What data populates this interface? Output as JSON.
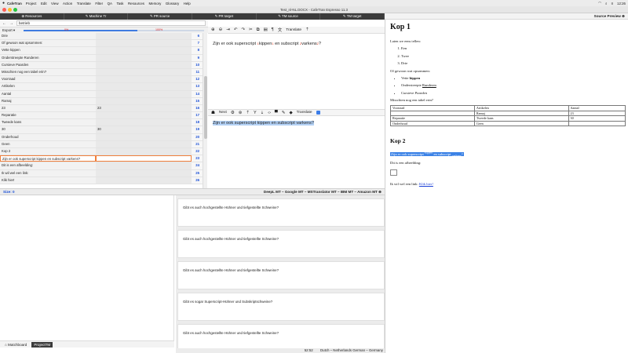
{
  "menubar": {
    "apple": "",
    "app": "CafeTran",
    "items": [
      "Project",
      "Edit",
      "View",
      "Action",
      "Translate",
      "Filter",
      "QA",
      "Task",
      "Resources",
      "Memory",
      "Glossary",
      "Help"
    ],
    "clock": "12:26"
  },
  "window": {
    "title": "Test_nl-NL.DOCX - CafeTran Espresso 11.3"
  },
  "tabs": [
    "⊕ Resources",
    "✎ Machine Tr",
    "✎ PR source",
    "✎ PR target",
    "✎ TM source",
    "✎ TM target"
  ],
  "preview_title": "Source Preview ⊕",
  "search": {
    "value": "betrieb"
  },
  "export": {
    "label": "Export ▾",
    "progress_fraction": 0.63,
    "pct_left": "0%",
    "pct_right": "100%"
  },
  "segments": [
    {
      "src": "Drie",
      "tgt": "",
      "num": "6"
    },
    {
      "src": "Of gewoon wat opsommen:",
      "tgt": "",
      "num": "7"
    },
    {
      "src": "Vette kippen",
      "tgt": "",
      "num": "8"
    },
    {
      "src": "Onderstreepte Runderen",
      "tgt": "",
      "num": "9"
    },
    {
      "src": "Cursieve Paarden",
      "tgt": "",
      "num": "10"
    },
    {
      "src": "Misschien nog een tabel erin?",
      "tgt": "",
      "num": "11"
    },
    {
      "src": "Voorraad",
      "tgt": "",
      "num": "12"
    },
    {
      "src": "Artikelen",
      "tgt": "",
      "num": "13"
    },
    {
      "src": "Aantal",
      "tgt": "",
      "num": "14"
    },
    {
      "src": "Ramaj",
      "tgt": "",
      "num": "15"
    },
    {
      "src": "23",
      "tgt": "23",
      "num": "16"
    },
    {
      "src": "Reparatie",
      "tgt": "",
      "num": "17"
    },
    {
      "src": "Tweede kans",
      "tgt": "",
      "num": "18"
    },
    {
      "src": "30",
      "tgt": "30",
      "num": "19"
    },
    {
      "src": "Onderhoud",
      "tgt": "",
      "num": "20"
    },
    {
      "src": "Geen",
      "tgt": "",
      "num": "21"
    },
    {
      "src": "Kop 2",
      "tgt": "",
      "num": "22"
    },
    {
      "src": "Zijn er ook superscript kippen en subscript varkens?",
      "tgt": "",
      "num": "23",
      "active": true
    },
    {
      "src": "Dit is een afbeelding:",
      "tgt": "",
      "num": "24"
    },
    {
      "src": "Ik wil wel een link:",
      "tgt": "",
      "num": "25"
    },
    {
      "src": "Klik hier!",
      "tgt": "",
      "num": "26"
    }
  ],
  "src_toolbar": {
    "translate_label": "Translate"
  },
  "source_editor": {
    "p1": "Zijn er ook superscript ",
    "t1": "1",
    "p2": "kippen",
    "t2": "1",
    "p3": " en subscript ",
    "t3": "2",
    "p4": "varkens",
    "t4": "2",
    "p5": "?"
  },
  "tgt_toolbar": {
    "next_label": "Next",
    "translate_label": "Translate"
  },
  "target_editor": {
    "text": "Zijn er ook superscript kippen en subscript varkens?"
  },
  "mtbar": {
    "size": "Size: 0",
    "engines": "DeepL MT – Google MT – MSTranslator MT – IBM MT – Amazon MT ⊕"
  },
  "mt_results": [
    "Gibt es auch hochgestellte Hühner und tiefgestellte Schweine?",
    "Gibt es auch hochgestellte Hühner und tiefgestellte Schweine?",
    "Gibt es auch hochgestellte Hühner und tiefgestellte Schweine?",
    "Gibt es sogar Superscript-Hühner und Subskriptschweine?",
    "Gibt es auch hochgestellte Hühner und tiefgestellte Schweine?"
  ],
  "bottom_tabs": [
    "⌂ Matchboard",
    "ProjectTM"
  ],
  "status": {
    "count": "52:52",
    "langs": "Dutch – Netherlands German – Germany"
  },
  "preview": {
    "h1": "Kop 1",
    "intro": "Laten we eens tellen:",
    "ol": [
      "Een",
      "Twee",
      "Drie"
    ],
    "list_intro": "Of gewoon wat opsommen:",
    "ul": [
      {
        "pre": "Vette ",
        "em": "kippen",
        "style": "bold"
      },
      {
        "pre": "Onderstreepte ",
        "em": "Runderen",
        "style": "underline"
      },
      {
        "pre": "Cursieve ",
        "em": "Paarden",
        "style": "italic"
      }
    ],
    "table_intro": "Misschien nog een tabel erin?",
    "table": [
      [
        "Voorraad",
        "Artikelen",
        "Aantal"
      ],
      [
        "",
        "Ramaj",
        "23"
      ],
      [
        "Reparatie",
        "Tweede kans",
        "30"
      ],
      [
        "Onderhoud",
        "Geen",
        ""
      ]
    ],
    "h2": "Kop 2",
    "hl_a": "Zijn er ook superscript ",
    "hl_sup": "kippen",
    "hl_b": " en subscript ",
    "hl_sub": "varkens",
    "hl_c": "?",
    "img_label": "Dit is een afbeelding:",
    "link_label": "Ik wil wel een link: ",
    "link_text": "Klik hier!"
  }
}
